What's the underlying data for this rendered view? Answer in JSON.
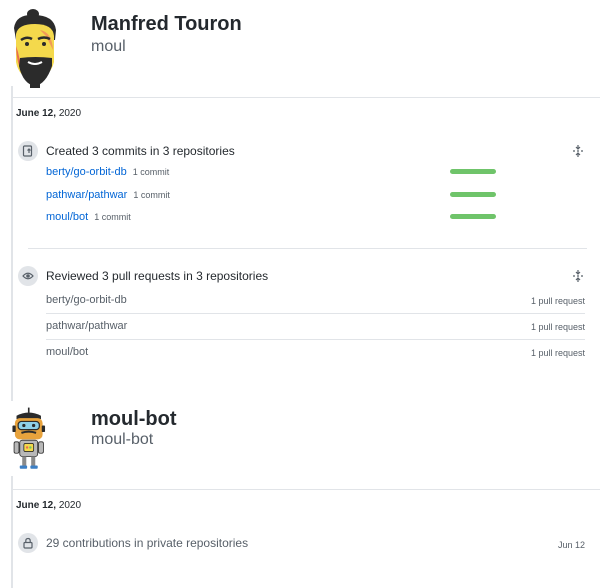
{
  "profiles": [
    {
      "full_name": "Manfred Touron",
      "username": "moul",
      "avatar_icon": "cartoon-man-avatar-icon",
      "date": {
        "month_day": "June 12,",
        "year": "2020"
      },
      "commits": {
        "title": "Created 3 commits in 3 repositories",
        "icon": "repo-push-icon",
        "repos": [
          {
            "name": "berty/go-orbit-db",
            "count": "1 commit",
            "share": 1.0
          },
          {
            "name": "pathwar/pathwar",
            "count": "1 commit",
            "share": 1.0
          },
          {
            "name": "moul/bot",
            "count": "1 commit",
            "share": 1.0
          }
        ]
      },
      "reviews": {
        "title": "Reviewed 3 pull requests in 3 repositories",
        "icon": "eye-icon",
        "repos": [
          {
            "name": "berty/go-orbit-db",
            "count": "1 pull request"
          },
          {
            "name": "pathwar/pathwar",
            "count": "1 pull request"
          },
          {
            "name": "moul/bot",
            "count": "1 pull request"
          }
        ]
      }
    },
    {
      "full_name": "moul-bot",
      "username": "moul-bot",
      "avatar_icon": "robot-avatar-icon",
      "date": {
        "month_day": "June 12,",
        "year": "2020"
      },
      "private": {
        "title": "29 contributions in private repositories",
        "icon": "lock-icon",
        "date": "Jun 12"
      }
    }
  ],
  "colors": {
    "link": "#0366d6",
    "bar": "#6fc46a",
    "border": "#e1e4e8"
  }
}
